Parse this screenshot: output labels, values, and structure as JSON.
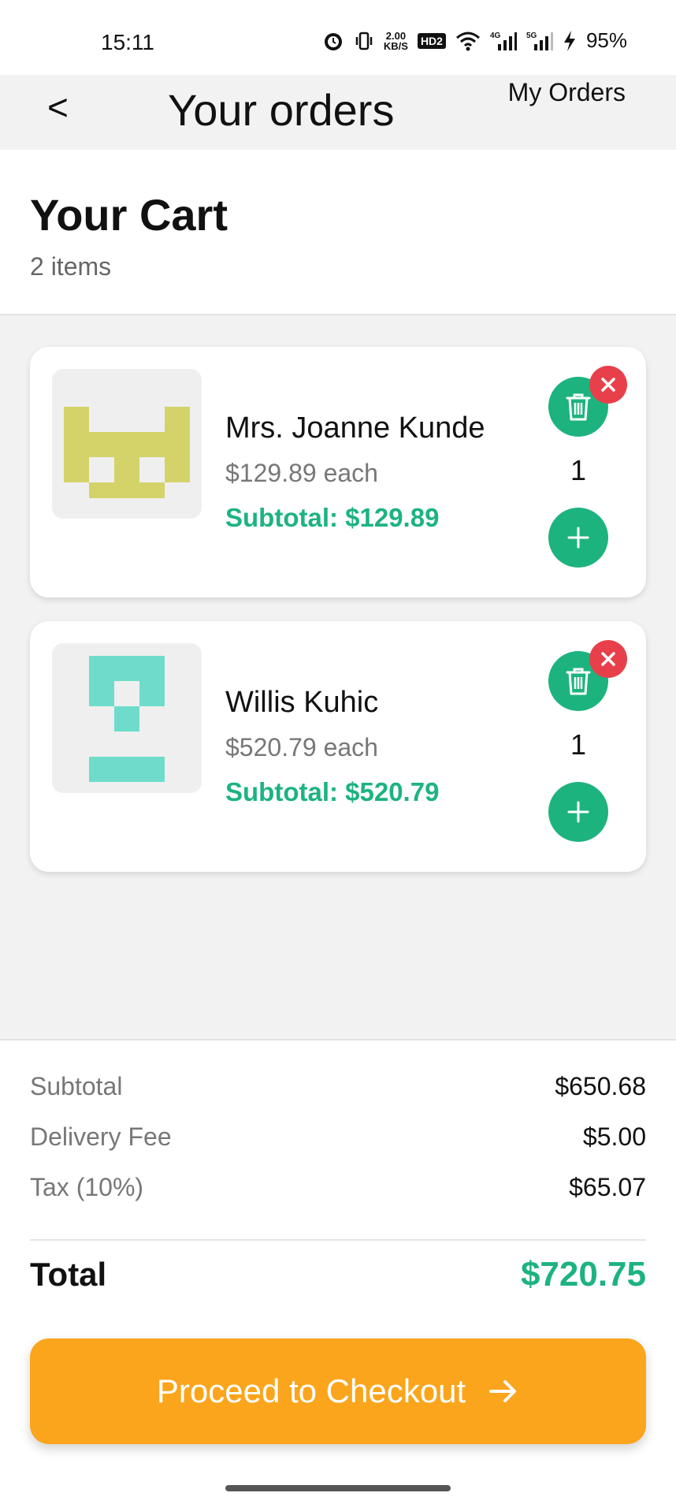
{
  "status_bar": {
    "time": "15:11",
    "net_speed_value": "2.00",
    "net_speed_unit": "KB/S",
    "hd_badge": "HD2",
    "net_4g": "4G",
    "net_5g": "5G",
    "battery": "95%",
    "icons": [
      "alarm-icon",
      "vibrate-icon",
      "wifi-icon",
      "signal-icon",
      "charging-icon"
    ]
  },
  "header": {
    "back_label": "<",
    "title": "Your orders",
    "link_label": "My Orders"
  },
  "cart": {
    "title": "Your Cart",
    "count_label": "2 items"
  },
  "items": [
    {
      "name": "Mrs. Joanne Kunde",
      "price_label": "$129.89 each",
      "subtotal_label": "Subtotal: $129.89",
      "quantity": "1",
      "thumb_color": "#d4d36a"
    },
    {
      "name": "Willis Kuhic",
      "price_label": "$520.79 each",
      "subtotal_label": "Subtotal: $520.79",
      "quantity": "1",
      "thumb_color": "#6fdccb"
    }
  ],
  "summary": {
    "subtotal_label": "Subtotal",
    "subtotal_value": "$650.68",
    "delivery_label": "Delivery Fee",
    "delivery_value": "$5.00",
    "tax_label": "Tax (10%)",
    "tax_value": "$65.07",
    "total_label": "Total",
    "total_value": "$720.75"
  },
  "checkout": {
    "label": "Proceed to Checkout"
  },
  "colors": {
    "accent_green": "#1db37f",
    "checkout_orange": "#fba51c",
    "remove_red": "#e8404a"
  }
}
